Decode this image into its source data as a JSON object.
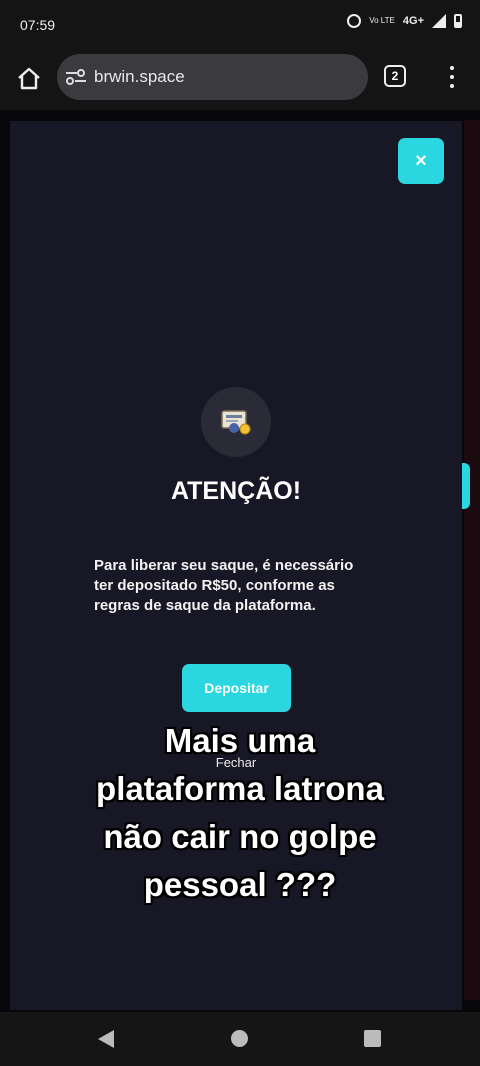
{
  "status_bar": {
    "time": "07:59",
    "volte_label": "Vo LTE",
    "network": "4G+"
  },
  "browser": {
    "url": "brwin.space",
    "tab_count": "2"
  },
  "modal": {
    "close_label": "×",
    "title": "ATENÇÃO!",
    "message": "Para liberar seu saque, é necessário ter depositado R$50, conforme as regras de saque da plataforma.",
    "deposit_label": "Depositar",
    "dismiss_label": "Fechar",
    "accent_color": "#2ad7e0"
  },
  "caption": {
    "lines": [
      "Mais uma",
      "plataforma latrona",
      "não cair no golpe",
      "pessoal ???"
    ]
  },
  "nav": {
    "icons": [
      "back-icon",
      "home-icon",
      "recents-icon"
    ]
  }
}
